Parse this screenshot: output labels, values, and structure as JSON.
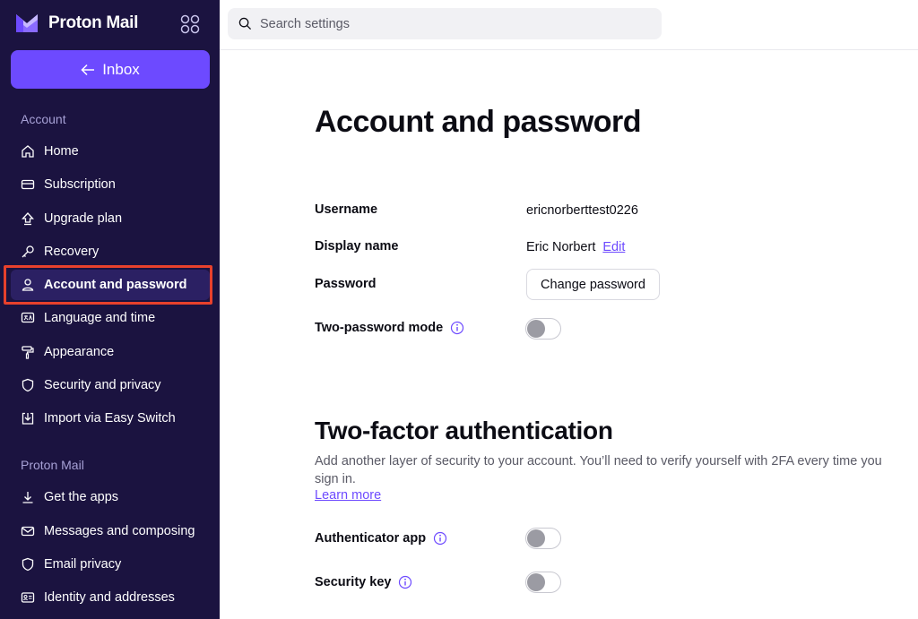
{
  "app": {
    "brand_name": "Proton Mail",
    "accent_color": "#6d4aff",
    "sidebar_color": "#1b1340"
  },
  "sidebar": {
    "inbox_button": "Inbox",
    "account_section": "Account",
    "account_items": [
      {
        "label": "Home",
        "icon": "home-icon"
      },
      {
        "label": "Subscription",
        "icon": "credit-card-icon"
      },
      {
        "label": "Upgrade plan",
        "icon": "upgrade-arrow-icon"
      },
      {
        "label": "Recovery",
        "icon": "key-icon"
      },
      {
        "label": "Account and password",
        "icon": "user-icon",
        "active": true
      },
      {
        "label": "Language and time",
        "icon": "language-icon"
      },
      {
        "label": "Appearance",
        "icon": "paint-roller-icon"
      },
      {
        "label": "Security and privacy",
        "icon": "shield-icon"
      },
      {
        "label": "Import via Easy Switch",
        "icon": "import-icon"
      }
    ],
    "mail_section": "Proton Mail",
    "mail_items": [
      {
        "label": "Get the apps",
        "icon": "download-icon"
      },
      {
        "label": "Messages and composing",
        "icon": "envelope-icon"
      },
      {
        "label": "Email privacy",
        "icon": "shield-icon"
      },
      {
        "label": "Identity and addresses",
        "icon": "id-card-icon"
      }
    ]
  },
  "search": {
    "placeholder": "Search settings"
  },
  "main": {
    "title": "Account and password",
    "fields": {
      "username_label": "Username",
      "username_value": "ericnorberttest0226",
      "display_name_label": "Display name",
      "display_name_value": "Eric Norbert",
      "edit_link": "Edit",
      "password_label": "Password",
      "change_password_button": "Change password",
      "two_password_label": "Two-password mode",
      "two_password_enabled": false
    },
    "two_factor": {
      "title": "Two-factor authentication",
      "description": "Add another layer of security to your account. You’ll need to verify yourself with 2FA every time you sign in.",
      "learn_more": "Learn more",
      "authenticator_label": "Authenticator app",
      "authenticator_enabled": false,
      "security_key_label": "Security key",
      "security_key_enabled": false
    }
  }
}
